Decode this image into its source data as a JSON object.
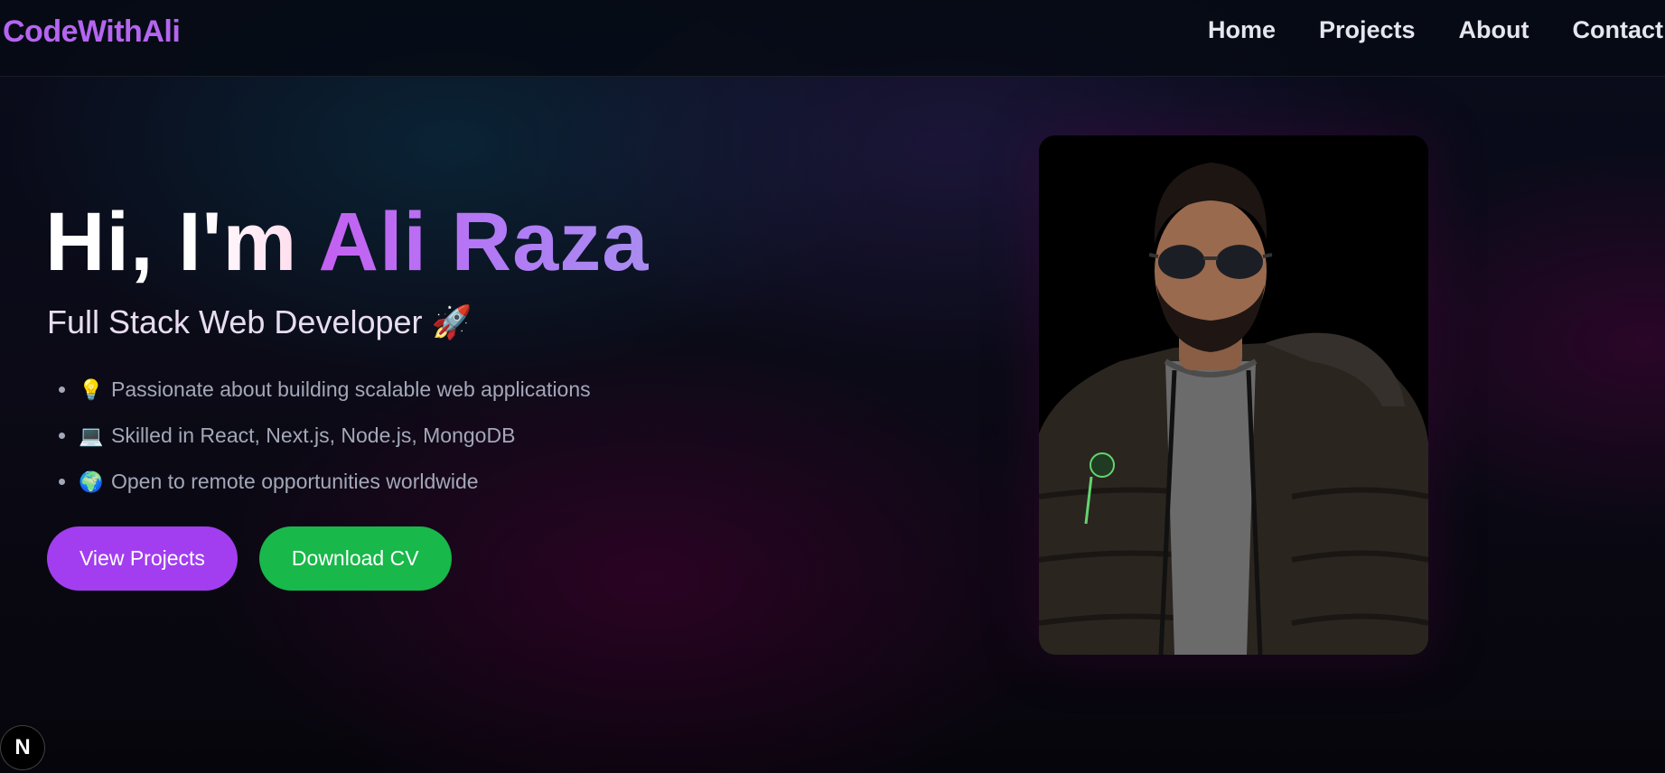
{
  "header": {
    "logo": "CodeWithAli",
    "nav": [
      {
        "label": "Home"
      },
      {
        "label": "Projects"
      },
      {
        "label": "About"
      },
      {
        "label": "Contact"
      }
    ]
  },
  "hero": {
    "greeting": "Hi, I'm ",
    "name": "Ali Raza",
    "subtitle": "Full Stack Web Developer 🚀",
    "features": [
      {
        "icon": "💡",
        "icon_name": "lightbulb-icon",
        "text": "Passionate about building scalable web applications"
      },
      {
        "icon": "💻",
        "icon_name": "laptop-icon",
        "text": "Skilled in React, Next.js, Node.js, MongoDB"
      },
      {
        "icon": "🌍",
        "icon_name": "globe-icon",
        "text": "Open to remote opportunities worldwide"
      }
    ],
    "buttons": {
      "primary": "View Projects",
      "secondary": "Download CV"
    }
  },
  "portrait": {
    "subject": "portrait-photo"
  },
  "dev_indicator": {
    "label": "N",
    "icon_name": "nextjs-icon"
  },
  "colors": {
    "accent": "#b565f0",
    "primary_button": "#a23ef0",
    "secondary_button": "#18b84a",
    "background": "#05060c"
  }
}
